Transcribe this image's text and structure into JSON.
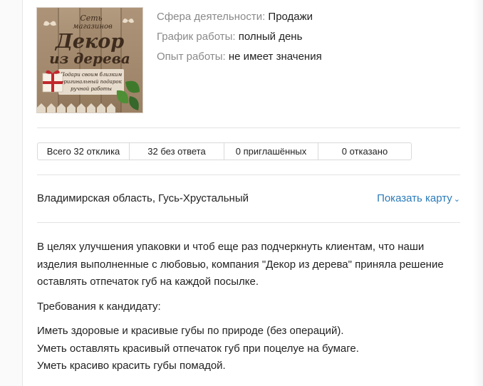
{
  "logo": {
    "line1": "Сеть",
    "line2": "магазинов",
    "line3": "Декор",
    "line4": "из дерева",
    "tag1": "Подари своим близким",
    "tag2": "оригинальный подарок",
    "tag3": "ручной работы"
  },
  "meta": [
    {
      "key": "Сфера деятельности:",
      "value": "Продажи"
    },
    {
      "key": "График работы:",
      "value": "полный день"
    },
    {
      "key": "Опыт работы:",
      "value": "не имеет значения"
    }
  ],
  "stats": [
    "Всего 32 отклика",
    "32 без ответа",
    "0 приглашённых",
    "0 отказано"
  ],
  "location": "Владимирская область, Гусь-Хрустальный",
  "map_link": "Показать карту",
  "description": {
    "intro": "В целях улучшения упаковки и чтоб еще раз подчеркнуть клиентам, что наши изделия выполненные с любовью, компания \"Декор из дерева\" приняла решение оставлять отпечаток губ на каждой посылке.",
    "requirements_title": "Требования к кандидату:",
    "requirements": [
      "Иметь здоровые и красивые губы по природе (без операций).",
      "Уметь оставлять красивый отпечаток губ при поцелуе на бумаге.",
      "Уметь красиво красить губы помадой."
    ]
  },
  "colors": {
    "link": "#2b7bb9",
    "muted": "#8a8a8a",
    "wood": "#8b7355",
    "logo_text": "#4a3626"
  }
}
